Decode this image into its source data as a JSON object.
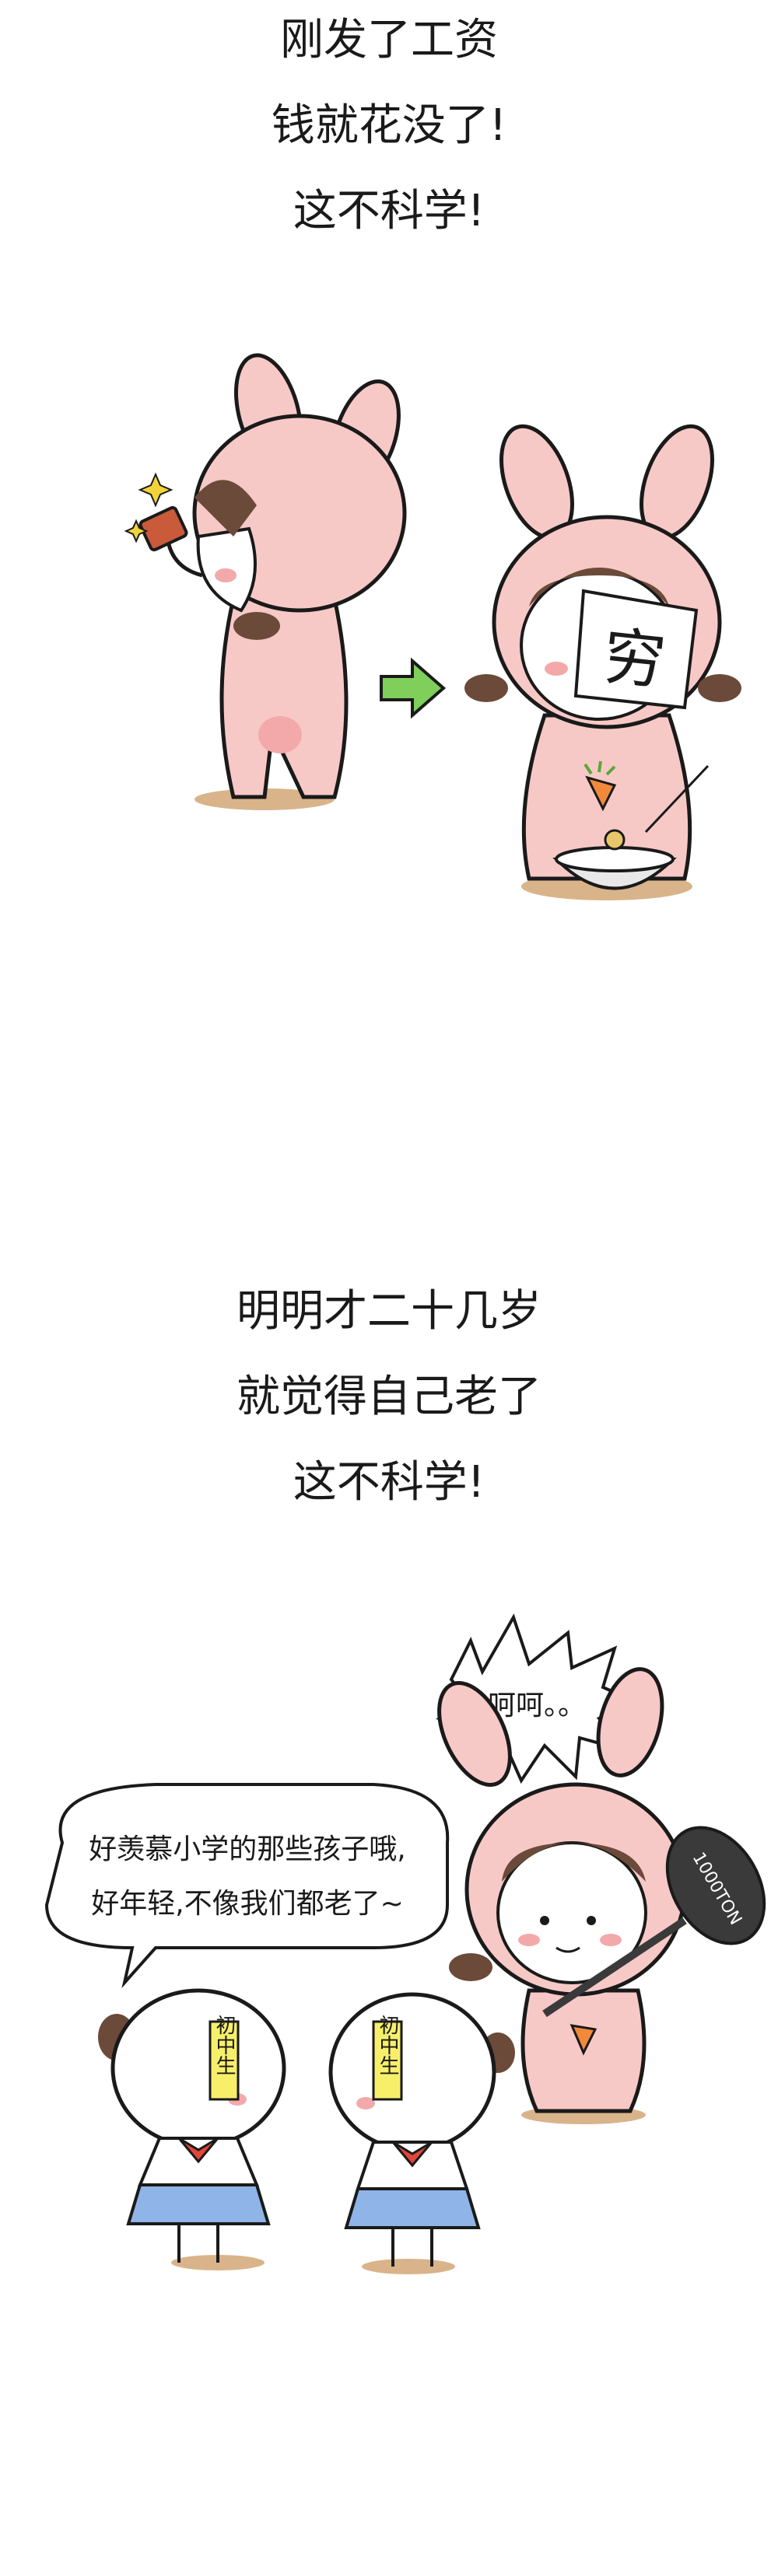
{
  "panel1": {
    "captions": [
      "刚发了工资",
      "钱就花没了!",
      "这不科学!"
    ],
    "sign_text": "穷"
  },
  "panel2": {
    "captions": [
      "明明才二十几岁",
      "就觉得自己老了",
      "这不科学!"
    ],
    "bubble_right": "呵呵。。",
    "bubble_left_line1": "好羡慕小学的那些孩子哦,",
    "bubble_left_line2": "好年轻,不像我们都老了~",
    "weight_text": "1000TON",
    "tag_left": "初中生",
    "tag_right": "初中生"
  },
  "colors": {
    "bunny_pink": "#f7c9c6",
    "bunny_inner": "#f3a9a9",
    "hair": "#6b4a3a",
    "shadow": "#d9b48a",
    "arrow_green": "#7fcf5a",
    "skirt_blue": "#8fb4e8",
    "bow_red": "#e2453a",
    "tag_yellow": "#f7ef6a",
    "weight_dark": "#3a3a3a"
  }
}
